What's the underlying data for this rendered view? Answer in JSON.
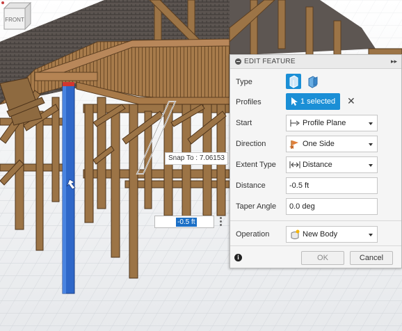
{
  "viewcube": {
    "face_label": "FRONT"
  },
  "snap_tooltip": "Snap To : 7.06153",
  "canvas_distance_value": "-0.5 ft",
  "panel": {
    "title": "EDIT FEATURE",
    "rows": {
      "type": "Type",
      "profiles": "Profiles",
      "start": "Start",
      "direction": "Direction",
      "extent_type": "Extent Type",
      "distance": "Distance",
      "taper_angle": "Taper Angle",
      "operation": "Operation"
    },
    "profiles_value": "1 selected",
    "start_value": "Profile Plane",
    "direction_value": "One Side",
    "extent_type_value": "Distance",
    "distance_value": "-0.5 ft",
    "taper_angle_value": "0.0 deg",
    "operation_value": "New Body",
    "ok_label": "OK",
    "cancel_label": "Cancel"
  },
  "colors": {
    "accent": "#1b8fd6",
    "wood": "#9c7446",
    "selection_blue": "#2f67c8"
  },
  "icons": [
    "collapse-icon",
    "expand-panel-icon",
    "extrude-solid-icon",
    "extrude-surface-icon",
    "cursor-arrow-icon",
    "clear-selection-icon",
    "profile-plane-icon",
    "direction-flag-icon",
    "distance-extent-icon",
    "new-body-icon",
    "info-icon",
    "gear-icon",
    "view-cube-icon"
  ]
}
